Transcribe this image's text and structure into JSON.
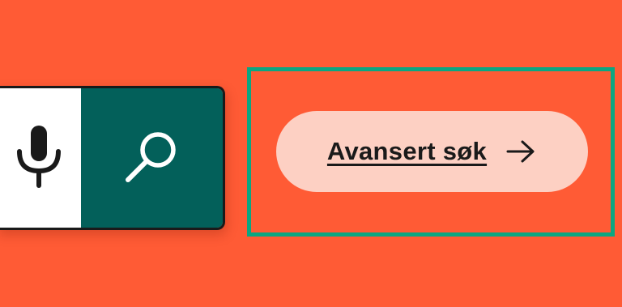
{
  "search": {
    "mic_icon": "microphone-icon",
    "search_icon": "magnifier-icon"
  },
  "advanced_search": {
    "label": "Avansert søk",
    "icon": "arrow-right-icon"
  },
  "colors": {
    "background": "#FF5B35",
    "search_button": "#03605A",
    "mic_button": "#FFFFFF",
    "focus_ring": "#0BA681",
    "pill": "#FDD0C3",
    "text": "#1A1A1A"
  }
}
